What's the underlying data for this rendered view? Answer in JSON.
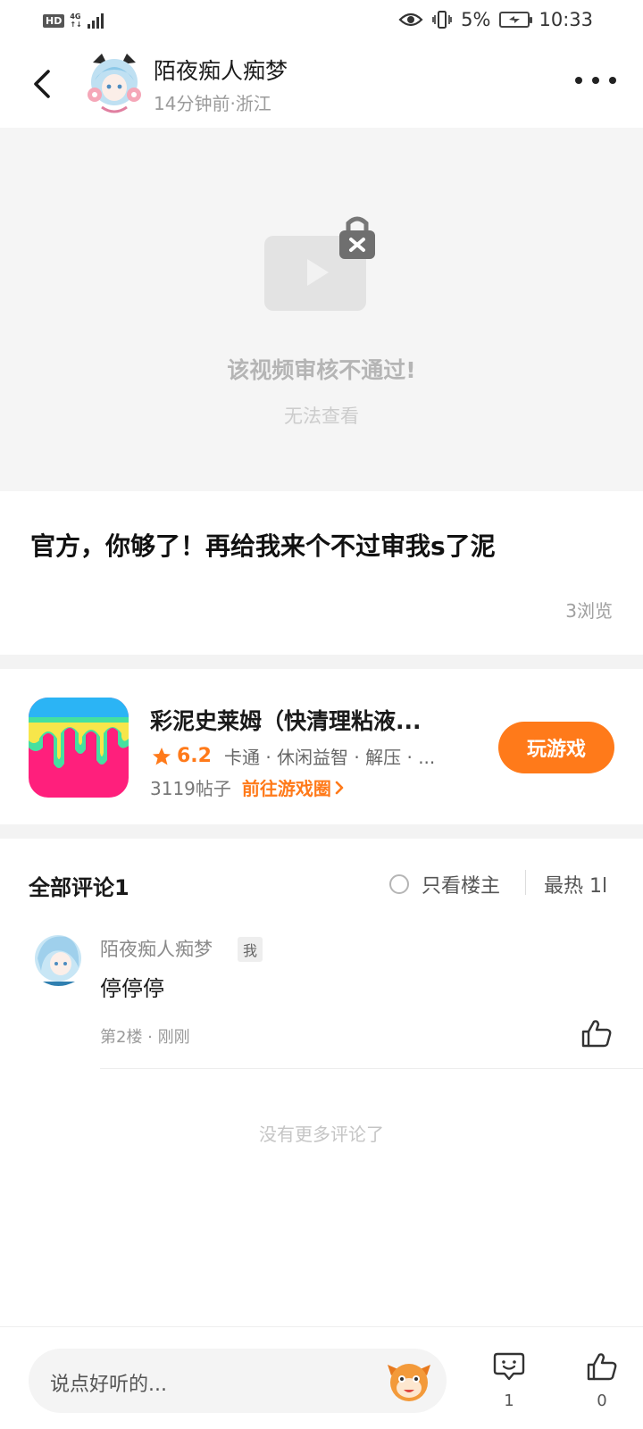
{
  "status_bar": {
    "hd": "HD",
    "net_top": "4G",
    "net_bottom": "↑↓",
    "battery_pct": "5%",
    "time": "10:33"
  },
  "header": {
    "author_name": "陌夜痴人痴梦",
    "meta": "14分钟前·浙江"
  },
  "video": {
    "blocked_title": "该视频审核不通过!",
    "blocked_sub": "无法查看"
  },
  "post": {
    "text": "官方，你够了！再给我来个不过审我s了泥",
    "views": "3浏览"
  },
  "game": {
    "title": "彩泥史莱姆（快清理粘液...",
    "rating": "6.2",
    "tags": "卡通 · 休闲益智 · 解压 · ...",
    "posts": "3119帖子",
    "circle_link": "前往游戏圈",
    "play_label": "玩游戏",
    "accent_color": "#ff7a1a"
  },
  "comments": {
    "heading": "全部评论1",
    "owner_only": "只看楼主",
    "sort": "最热 1l",
    "items": [
      {
        "author": "陌夜痴人痴梦",
        "badge": "我",
        "text": "停停停",
        "meta": "第2楼 · 刚刚"
      }
    ],
    "no_more": "没有更多评论了"
  },
  "bottom_bar": {
    "placeholder": "说点好听的...",
    "comment_count": "1",
    "like_count": "0"
  }
}
